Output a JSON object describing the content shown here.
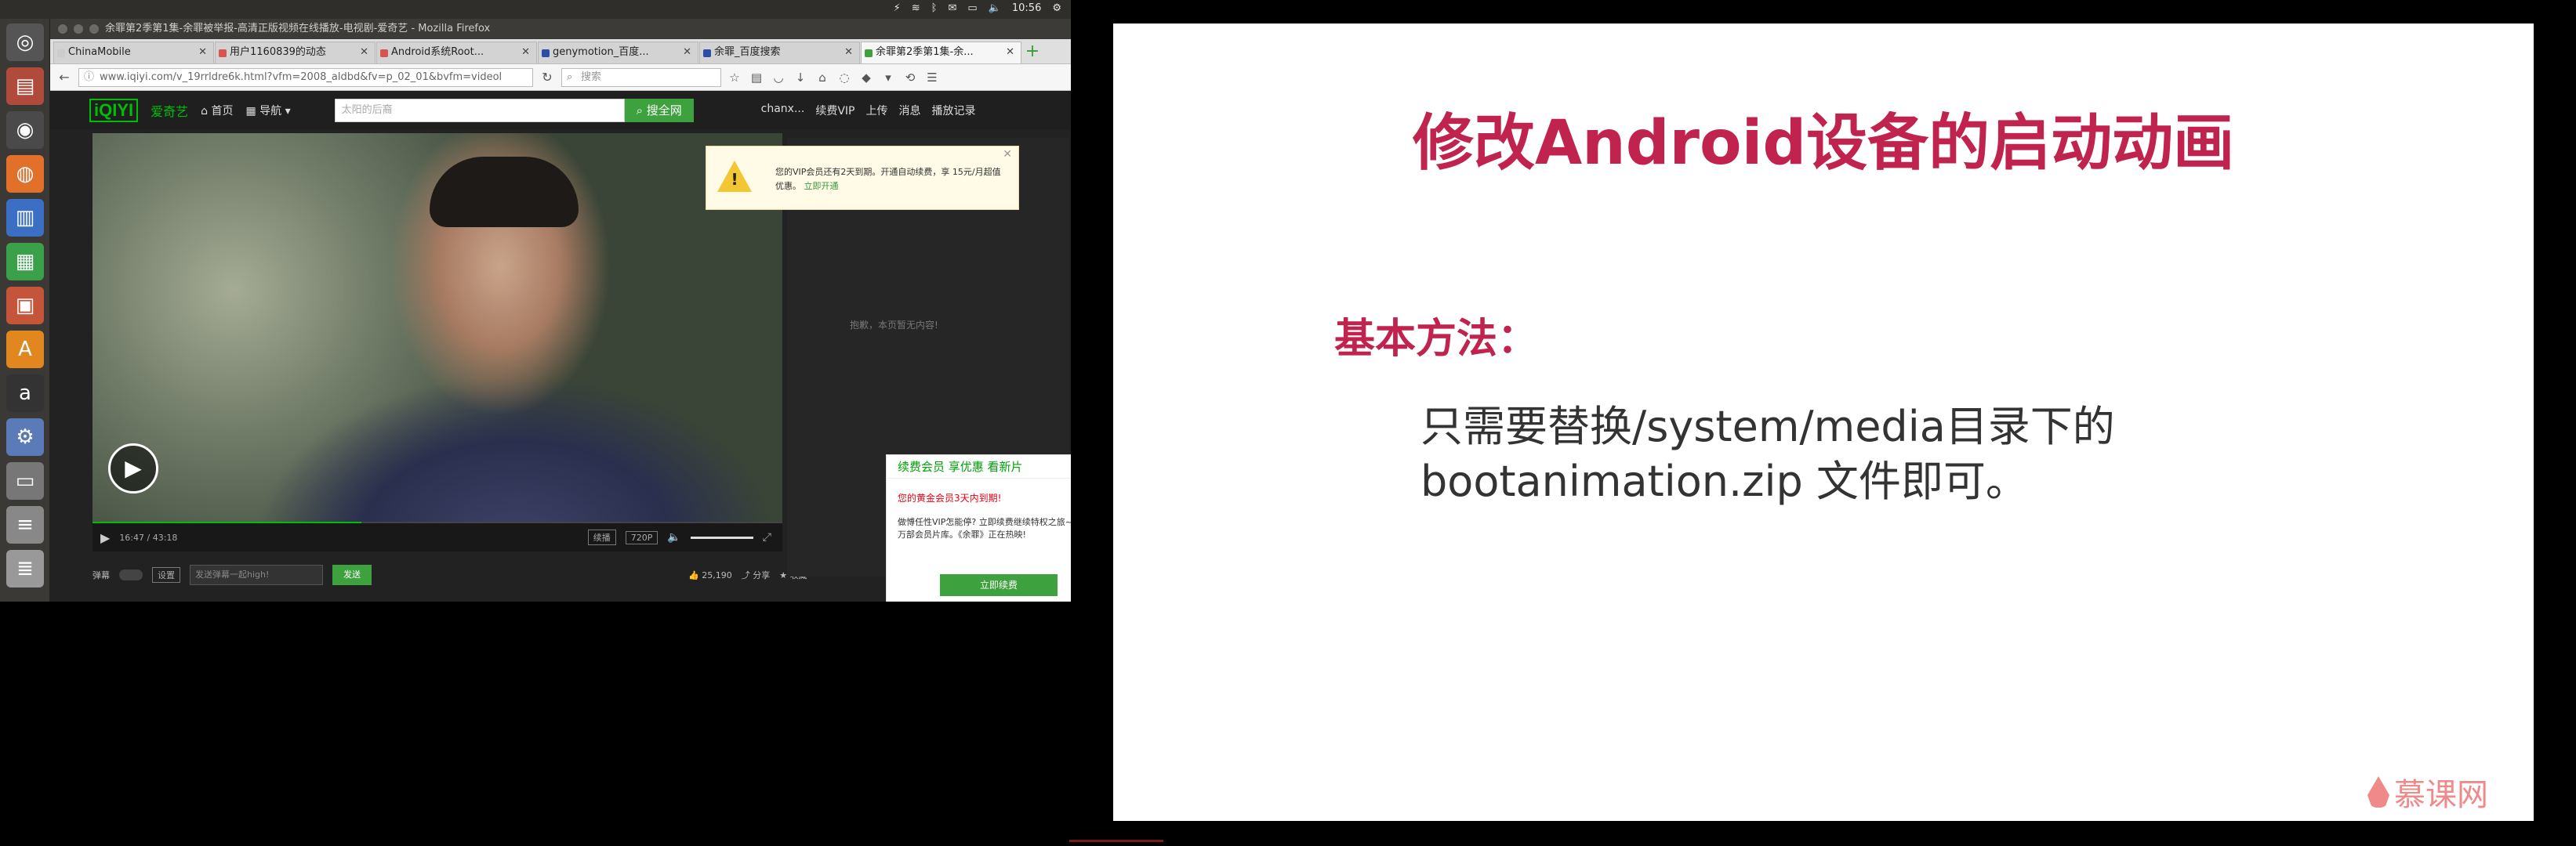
{
  "system": {
    "time": "10:56"
  },
  "firefox": {
    "window_title": "余罪第2季第1集-余罪被举报-高清正版视频在线播放-电视剧-爱奇艺 - Mozilla Firefox",
    "tabs": [
      {
        "label": "ChinaMobile",
        "color": "#cccccc"
      },
      {
        "label": "用户1160839的动态",
        "color": "#d9534f"
      },
      {
        "label": "Android系统Root...",
        "color": "#d9534f"
      },
      {
        "label": "genymotion_百度...",
        "color": "#2d4ea8"
      },
      {
        "label": "余罪_百度搜索",
        "color": "#2d4ea8"
      },
      {
        "label": "余罪第2季第1集-余...",
        "color": "#3da23d"
      }
    ],
    "url": "www.iqiyi.com/v_19rrldre6k.html?vfm=2008_aldbd&fv=p_02_01&bvfm=videol",
    "search_placeholder": "搜索"
  },
  "iqiyi": {
    "logo": "iQIYI",
    "logo_cn": "爱奇艺",
    "nav_home": "首页",
    "nav_guide": "导航",
    "search_placeholder": "太阳的后裔",
    "search_button": "搜全网",
    "user_menu": [
      "chanx...",
      "续费VIP",
      "上传",
      "消息",
      "播放记录"
    ],
    "vip_tip": {
      "text": "您的VIP会员还有2天到期。开通自动续费，享 15元/月超值优惠。",
      "link": "立即开通"
    },
    "sidebar_empty": "抱歉，本页暂无内容!",
    "controls": {
      "time": "16:47 / 43:18",
      "btn_continue": "续播",
      "quality": "720P"
    },
    "bullet": {
      "label": "弹幕",
      "settings": "设置",
      "placeholder": "发送弹幕一起high!",
      "send": "发送",
      "likes": "25,190",
      "share": "分享",
      "collect": "收藏"
    },
    "renew": {
      "title": "续费会员 享优惠 看新片",
      "expire": "您的黄金会员3天内到期!",
      "body": "做愽任性VIP怎能停? 立即续费继续特权之旅~任享近万部会员片库。《余罪》正在热映!",
      "button": "立即续费"
    }
  },
  "slide": {
    "title": "修改Android设备的启动动画",
    "section": "基本方法：",
    "body_line1": "只需要替换/system/media目录下的",
    "body_line2": "bootanimation.zip 文件即可。",
    "logo": "慕课网"
  }
}
